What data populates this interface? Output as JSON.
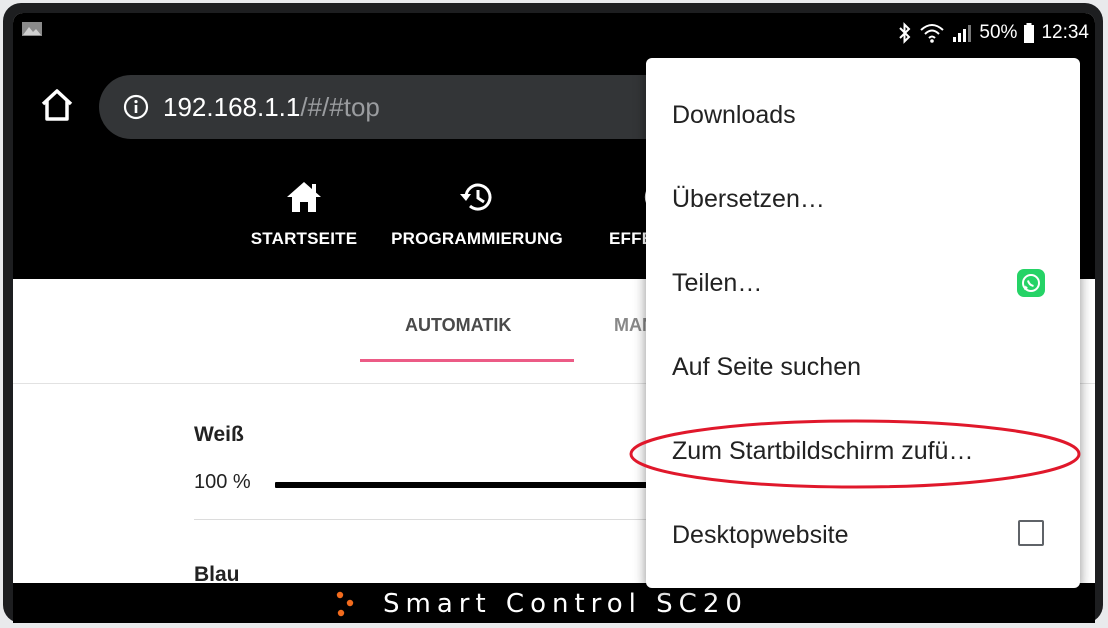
{
  "status_bar": {
    "battery_text": "50%",
    "time": "12:34",
    "icons": [
      "bluetooth-icon",
      "wifi-icon",
      "signal-icon",
      "battery-icon"
    ]
  },
  "browser": {
    "url_host": "192.168.1.1",
    "url_path": "/#/#top"
  },
  "app_nav": {
    "items": [
      {
        "label": "STARTSEITE",
        "icon": "home-icon"
      },
      {
        "label": "PROGRAMMIERUNG",
        "icon": "history-icon"
      },
      {
        "label": "EFFE",
        "icon": "moon-icon"
      }
    ]
  },
  "tabs": [
    {
      "label": "AUTOMATIK",
      "active": true
    },
    {
      "label": "MAN",
      "active": false
    }
  ],
  "channels": [
    {
      "name": "Weiß",
      "value": "100 %",
      "level": 1.0
    },
    {
      "name": "Blau"
    }
  ],
  "footer": {
    "brand": "Smart Control SC20"
  },
  "menu": {
    "items": [
      {
        "label": "Downloads"
      },
      {
        "label": "Übersetzen…"
      },
      {
        "label": "Teilen…",
        "icon": "whatsapp-icon"
      },
      {
        "label": "Auf Seite suchen"
      },
      {
        "label": "Zum Startbildschirm zufü…",
        "highlighted": true
      },
      {
        "label": "Desktopwebsite",
        "checkbox": false
      }
    ]
  },
  "colors": {
    "accent_indicator": "#ec5b86",
    "highlight_ellipse": "#e0182b",
    "whatsapp_green": "#25d366",
    "logo_orange": "#f26b1d"
  }
}
